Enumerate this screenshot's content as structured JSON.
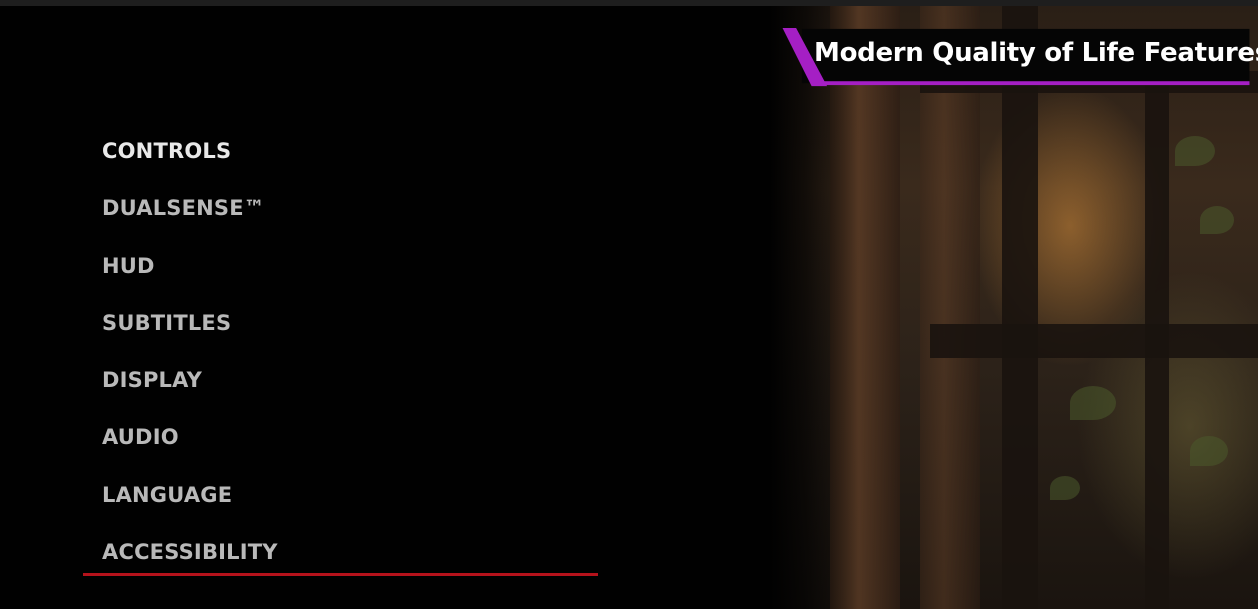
{
  "banner": {
    "title": "Modern Quality of Life Features",
    "accent_color": "#a51fc4"
  },
  "menu": {
    "selected_index": 0,
    "highlight_color": "#b5121b",
    "items": [
      {
        "label": "CONTROLS"
      },
      {
        "label": "DUALSENSE™"
      },
      {
        "label": "HUD"
      },
      {
        "label": "SUBTITLES"
      },
      {
        "label": "DISPLAY"
      },
      {
        "label": "AUDIO"
      },
      {
        "label": "LANGUAGE"
      },
      {
        "label": "ACCESSIBILITY"
      }
    ]
  }
}
